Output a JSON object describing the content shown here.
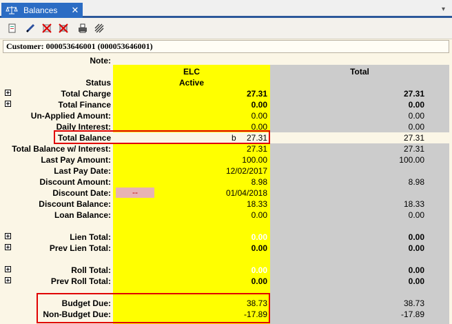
{
  "tab": {
    "title": "Balances",
    "close": "✕",
    "menu": "▾"
  },
  "toolbar": {
    "icons": [
      "document-icon",
      "pen-icon",
      "cancel-doc-icon",
      "void-icon",
      "print-icon",
      "stripe-icon"
    ]
  },
  "customer": {
    "text": "Customer: 000053646001 (000053646001)"
  },
  "headers": {
    "note": "Note:",
    "col1_name": "ELC",
    "col2_name": "Total",
    "status_label": "Status",
    "status_value": "Active"
  },
  "rows": [
    {
      "label": "Total Charge",
      "v1": "27.31",
      "v2": "27.31"
    },
    {
      "label": "Total Finance",
      "v1": "0.00",
      "v2": "0.00"
    },
    {
      "label": "Un-Applied Amount:",
      "v1": "0.00",
      "v2": "0.00"
    },
    {
      "label": "Daily Interest:",
      "v1": "0.00",
      "v2": "0.00"
    },
    {
      "label": "Total Balance",
      "prefix": "b",
      "v1": "27.31",
      "v2": "27.31"
    },
    {
      "label": "Total Balance w/ Interest:",
      "v1": "27.31",
      "v2": "27.31"
    },
    {
      "label": "Last Pay Amount:",
      "v1": "100.00",
      "v2": "100.00"
    },
    {
      "label": "Last Pay Date:",
      "v1": "12/02/2017",
      "v2": ""
    },
    {
      "label": "Discount Amount:",
      "v1": "8.98",
      "v2": "8.98"
    },
    {
      "label": "Discount Date:",
      "badge": "--",
      "v1": "01/04/2018",
      "v2": ""
    },
    {
      "label": "Discount Balance:",
      "v1": "18.33",
      "v2": "18.33"
    },
    {
      "label": "Loan Balance:",
      "v1": "0.00",
      "v2": "0.00"
    },
    {
      "label": "Lien Total:",
      "v1": "0.00",
      "v2": "0.00"
    },
    {
      "label": "Prev Lien Total:",
      "v1": "0.00",
      "v2": "0.00"
    },
    {
      "label": "Roll Total:",
      "v1": "0.00",
      "v2": "0.00"
    },
    {
      "label": "Prev Roll Total:",
      "v1": "0.00",
      "v2": "0.00"
    },
    {
      "label": "Budget Due:",
      "v1": "38.73",
      "v2": "38.73"
    },
    {
      "label": "Non-Budget Due:",
      "v1": "-17.89",
      "v2": "-17.89"
    }
  ],
  "colors": {
    "yellow": "#ffff00",
    "gray": "#cccccc",
    "highlight_border": "#e00000",
    "tab_blue": "#2b6cc4"
  }
}
